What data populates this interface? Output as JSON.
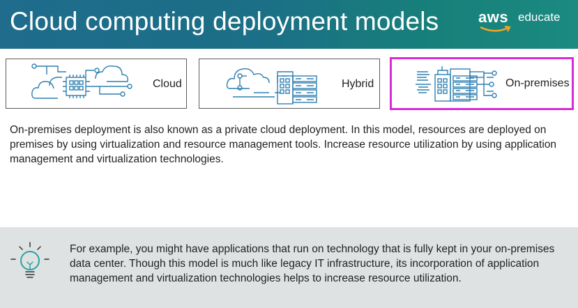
{
  "header": {
    "title": "Cloud computing deployment models",
    "logo": {
      "brand": "aws",
      "product": "educate"
    }
  },
  "cards": [
    {
      "label": "Cloud",
      "icon": "cloud-circuit-icon",
      "selected": false
    },
    {
      "label": "Hybrid",
      "icon": "hybrid-cloud-server-icon",
      "selected": false
    },
    {
      "label": "On-premises",
      "icon": "on-premises-building-server-icon",
      "selected": true
    }
  ],
  "description": "On-premises deployment is also known as a private cloud deployment. In this model, resources are deployed on premises by using virtualization and resource management tools. Increase resource utilization by using application management and virtualization technologies.",
  "tip": {
    "icon": "lightbulb-icon",
    "text": "For example, you might have applications that run on technology that is fully kept in your on-premises data center. Though this model is much like legacy IT infrastructure, its incorporation of application management and virtualization technologies helps to increase resource utilization."
  },
  "colors": {
    "header_start": "#1f6c8c",
    "header_end": "#1b8a80",
    "selected_border": "#d62bd6",
    "icon_stroke": "#2e7fb0",
    "tip_background": "#dfe2e2"
  }
}
